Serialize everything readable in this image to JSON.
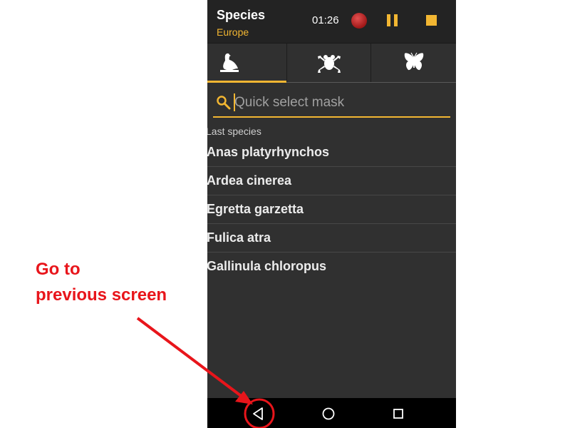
{
  "header": {
    "title": "Species",
    "subtitle": "Europe",
    "timer": "01:26",
    "record_icon": "record-icon",
    "pause_icon": "pause-icon",
    "stop_icon": "stop-icon"
  },
  "tabs": [
    {
      "icon": "bird-icon",
      "selected": true
    },
    {
      "icon": "frog-icon",
      "selected": false
    },
    {
      "icon": "butterfly-icon",
      "selected": false
    }
  ],
  "search": {
    "placeholder": "Quick select mask",
    "icon": "search-icon"
  },
  "section": {
    "title": "Last species"
  },
  "species": [
    "Anas platyrhynchos",
    "Ardea cinerea",
    "Egretta garzetta",
    "Fulica atra",
    "Gallinula chloropus"
  ],
  "navbar": {
    "back_icon": "back-triangle-icon",
    "home_icon": "home-circle-icon",
    "recents_icon": "recents-square-icon"
  },
  "annotation": {
    "line1": "Go to",
    "line2": "previous screen"
  },
  "colors": {
    "accent": "#f2b632",
    "background": "#303030",
    "appbar": "#232323",
    "annotation": "#e8151b"
  }
}
